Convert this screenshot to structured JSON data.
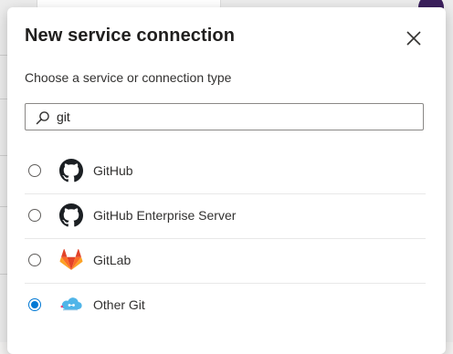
{
  "dialog": {
    "title": "New service connection",
    "subtitle": "Choose a service or connection type",
    "close_icon": "close-icon"
  },
  "search": {
    "value": "git",
    "icon": "search-icon"
  },
  "connections": [
    {
      "label": "GitHub",
      "icon": "github-icon",
      "selected": false
    },
    {
      "label": "GitHub Enterprise Server",
      "icon": "github-icon",
      "selected": false
    },
    {
      "label": "GitLab",
      "icon": "gitlab-icon",
      "selected": false
    },
    {
      "label": "Other Git",
      "icon": "other-git-icon",
      "selected": true
    }
  ],
  "colors": {
    "accent": "#0078d4",
    "gitlab_orange": "#fc6d26"
  }
}
